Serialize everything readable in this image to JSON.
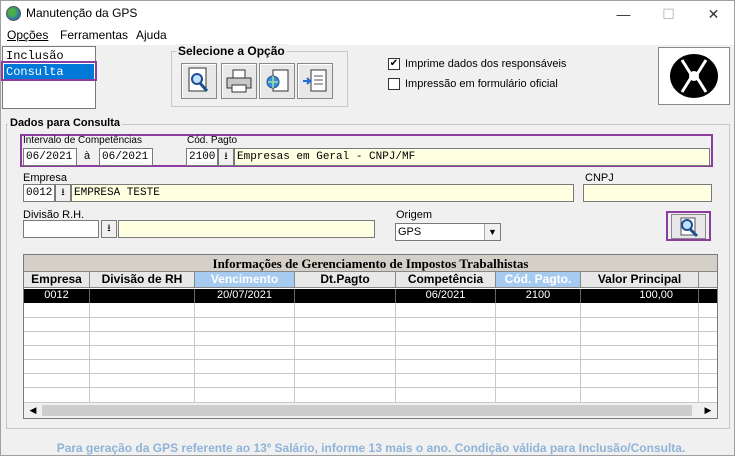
{
  "window": {
    "title": "Manutenção da GPS",
    "minimize": "—",
    "maximize": "☐",
    "close": "✕"
  },
  "menu": [
    {
      "label": "Opções"
    },
    {
      "label": "Ferramentas"
    },
    {
      "label": "Ajuda"
    }
  ],
  "modes": [
    {
      "label": "Inclusão"
    },
    {
      "label": "Consulta"
    }
  ],
  "options_group": {
    "title": "Selecione a Opção"
  },
  "checkboxes": [
    {
      "label": "Imprime dados dos responsáveis",
      "checked": true
    },
    {
      "label": "Impressão em formulário oficial",
      "checked": false
    }
  ],
  "consulta": {
    "section_title": "Dados para Consulta",
    "competencias_label": "Intervalo de Competências",
    "comp_from": "06/2021",
    "comp_sep": "à",
    "comp_to": "06/2021",
    "cod_pagto_label": "Cód. Pagto",
    "cod_pagto_value": "2100",
    "cod_pagto_desc": "Empresas em Geral - CNPJ/MF",
    "empresa_label": "Empresa",
    "empresa_code": "0012",
    "empresa_name": "EMPRESA TESTE",
    "cnpj_label": "CNPJ",
    "cnpj_value": "",
    "divisao_label": "Divisão R.H.",
    "divisao_value": "",
    "divisao_desc": "",
    "origem_label": "Origem",
    "origem_value": "GPS"
  },
  "grid": {
    "title": "Informações de Gerenciamento de Impostos Trabalhistas",
    "columns": [
      "Empresa",
      "Divisão de RH",
      "Vencimento",
      "Dt.Pagto",
      "Competência",
      "Cód. Pagto.",
      "Valor Principal"
    ],
    "rows": [
      [
        "0012",
        "",
        "20/07/2021",
        "",
        "06/2021",
        "2100",
        "100,00"
      ]
    ]
  },
  "footer": "Para geração da GPS referente ao 13º Salário, informe 13 mais o ano. Condição válida para Inclusão/Consulta."
}
